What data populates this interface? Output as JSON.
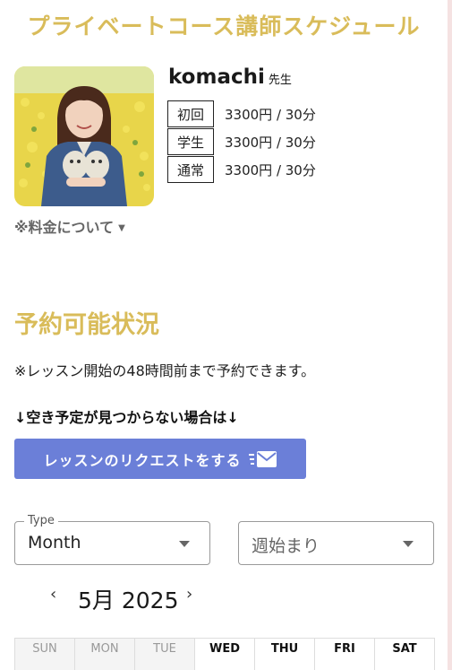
{
  "page": {
    "title": "プライベートコース講師スケジュール"
  },
  "teacher": {
    "name": "komachi",
    "suffix": "先生",
    "prices": [
      {
        "label": "初回",
        "value": "3300円 / 30分"
      },
      {
        "label": "学生",
        "value": "3300円 / 30分"
      },
      {
        "label": "通常",
        "value": "3300円 / 30分"
      }
    ],
    "fee_link": "※料金について"
  },
  "availability": {
    "title": "予約可能状況",
    "note": "※レッスン開始の48時間前まで予約できます。",
    "not_found": "↓空き予定が見つからない場合は↓",
    "request_button": "レッスンのリクエストをする"
  },
  "controls": {
    "type_legend": "Type",
    "type_value": "Month",
    "week_start_placeholder": "週始まり"
  },
  "calendar": {
    "month_label": "5月 2025",
    "prev": "‹",
    "next": "›",
    "days": [
      {
        "label": "SUN",
        "past": true
      },
      {
        "label": "MON",
        "past": true
      },
      {
        "label": "TUE",
        "past": true
      },
      {
        "label": "WED",
        "past": false
      },
      {
        "label": "THU",
        "past": false
      },
      {
        "label": "FRI",
        "past": false
      },
      {
        "label": "SAT",
        "past": false
      }
    ]
  },
  "colors": {
    "accent_gold": "#d9bc5a",
    "button_blue": "#6b7fd8"
  }
}
